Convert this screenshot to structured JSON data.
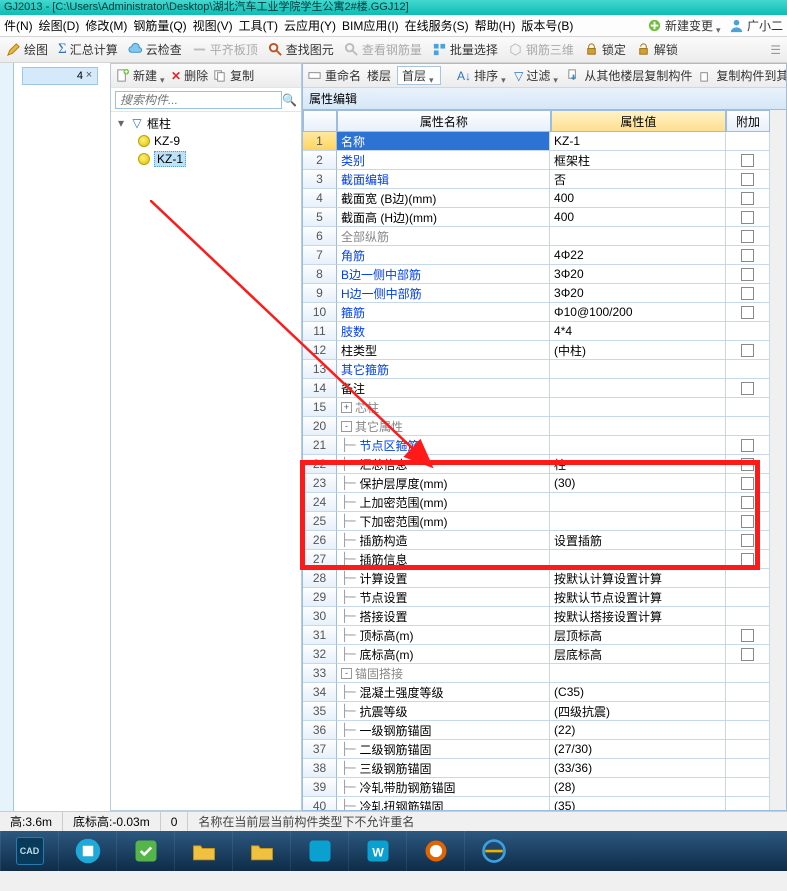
{
  "title": "GJ2013 - [C:\\Users\\Administrator\\Desktop\\湖北汽车工业学院学生公寓2#楼.GGJ12]",
  "menus": [
    "件(N)",
    "绘图(D)",
    "修改(M)",
    "钢筋量(Q)",
    "视图(V)",
    "工具(T)",
    "云应用(Y)",
    "BIM应用(I)",
    "在线服务(S)",
    "帮助(H)",
    "版本号(B)"
  ],
  "menu_end": {
    "new_change": "新建变更",
    "guangxiao": "广小二"
  },
  "toolbar1": {
    "draw": "绘图",
    "sum": "汇总计算",
    "cloud": "云检查",
    "level": "平齐板顶",
    "find": "查找图元",
    "steel": "查看钢筋量",
    "batch": "批量选择",
    "steel3d": "钢筋三维",
    "lock": "锁定",
    "unlock": "解锁"
  },
  "toolbar2": {
    "new": "新建",
    "del": "删除",
    "copy": "复制",
    "rename": "重命名",
    "floor": "楼层",
    "floor1": "首层",
    "sort": "排序",
    "filter": "过滤",
    "copyfloor": "从其他楼层复制构件",
    "copydest": "复制构件到其"
  },
  "search_placeholder": "搜索构件...",
  "tree": {
    "root": "框柱",
    "items": [
      "KZ-9",
      "KZ-1"
    ]
  },
  "prop_header": "属性编辑",
  "columns": {
    "name": "属性名称",
    "value": "属性值",
    "extra": "附加"
  },
  "rows": [
    {
      "n": 1,
      "name": "名称",
      "val": "KZ-1",
      "sel": true
    },
    {
      "n": 2,
      "name": "类别",
      "val": "框架柱",
      "link": true,
      "chk": true
    },
    {
      "n": 3,
      "name": "截面编辑",
      "val": "否",
      "link": true,
      "chk": true
    },
    {
      "n": 4,
      "name": "截面宽 (B边)(mm)",
      "val": "400",
      "chk": true
    },
    {
      "n": 5,
      "name": "截面高 (H边)(mm)",
      "val": "400",
      "chk": true
    },
    {
      "n": 6,
      "name": "全部纵筋",
      "val": "",
      "gray": true,
      "chk": true
    },
    {
      "n": 7,
      "name": "角筋",
      "val": "4Φ22",
      "link": true,
      "chk": true
    },
    {
      "n": 8,
      "name": "B边一侧中部筋",
      "val": "3Φ20",
      "link": true,
      "chk": true
    },
    {
      "n": 9,
      "name": "H边一侧中部筋",
      "val": "3Φ20",
      "link": true,
      "chk": true
    },
    {
      "n": 10,
      "name": "箍筋",
      "val": "Φ10@100/200",
      "link": true,
      "chk": true
    },
    {
      "n": 11,
      "name": "肢数",
      "val": "4*4",
      "link": true
    },
    {
      "n": 12,
      "name": "柱类型",
      "val": "(中柱)",
      "chk": true
    },
    {
      "n": 13,
      "name": "其它箍筋",
      "val": "",
      "link": true
    },
    {
      "n": 14,
      "name": "备注",
      "val": "",
      "chk": true
    },
    {
      "n": 15,
      "name": "芯柱",
      "val": "",
      "exp": "+",
      "gray": true
    },
    {
      "n": 20,
      "name": "其它属性",
      "val": "",
      "exp": "-",
      "gray": true
    },
    {
      "n": 21,
      "name": "节点区箍筋",
      "val": "",
      "indent": true,
      "link": true,
      "chk": true,
      "red": true
    },
    {
      "n": 22,
      "name": "汇总信息",
      "val": "柱",
      "indent": true,
      "chk": true
    },
    {
      "n": 23,
      "name": "保护层厚度(mm)",
      "val": "(30)",
      "indent": true,
      "chk": true
    },
    {
      "n": 24,
      "name": "上加密范围(mm)",
      "val": "",
      "indent": true,
      "chk": true
    },
    {
      "n": 25,
      "name": "下加密范围(mm)",
      "val": "",
      "indent": true,
      "chk": true
    },
    {
      "n": 26,
      "name": "插筋构造",
      "val": "设置插筋",
      "indent": true,
      "chk": true,
      "red": true
    },
    {
      "n": 27,
      "name": "插筋信息",
      "val": "",
      "indent": true,
      "chk": true
    },
    {
      "n": 28,
      "name": "计算设置",
      "val": "按默认计算设置计算",
      "indent": true
    },
    {
      "n": 29,
      "name": "节点设置",
      "val": "按默认节点设置计算",
      "indent": true
    },
    {
      "n": 30,
      "name": "搭接设置",
      "val": "按默认搭接设置计算",
      "indent": true
    },
    {
      "n": 31,
      "name": "顶标高(m)",
      "val": "层顶标高",
      "indent": true,
      "chk": true
    },
    {
      "n": 32,
      "name": "底标高(m)",
      "val": "层底标高",
      "indent": true,
      "chk": true
    },
    {
      "n": 33,
      "name": "锚固搭接",
      "val": "",
      "exp": "-",
      "gray": true
    },
    {
      "n": 34,
      "name": "混凝土强度等级",
      "val": "(C35)",
      "indent": true
    },
    {
      "n": 35,
      "name": "抗震等级",
      "val": "(四级抗震)",
      "indent": true
    },
    {
      "n": 36,
      "name": "一级钢筋锚固",
      "val": "(22)",
      "indent": true
    },
    {
      "n": 37,
      "name": "二级钢筋锚固",
      "val": "(27/30)",
      "indent": true
    },
    {
      "n": 38,
      "name": "三级钢筋锚固",
      "val": "(33/36)",
      "indent": true
    },
    {
      "n": 39,
      "name": "冷轧带肋钢筋锚固",
      "val": "(28)",
      "indent": true
    },
    {
      "n": 40,
      "name": "冷轧扭钢筋锚固",
      "val": "(35)",
      "indent": true
    }
  ],
  "status": {
    "height": "高:3.6m",
    "bottom": "底标高:-0.03m",
    "zero": "0",
    "msg": "名称在当前层当前构件类型下不允许重名"
  },
  "ruler": "4"
}
